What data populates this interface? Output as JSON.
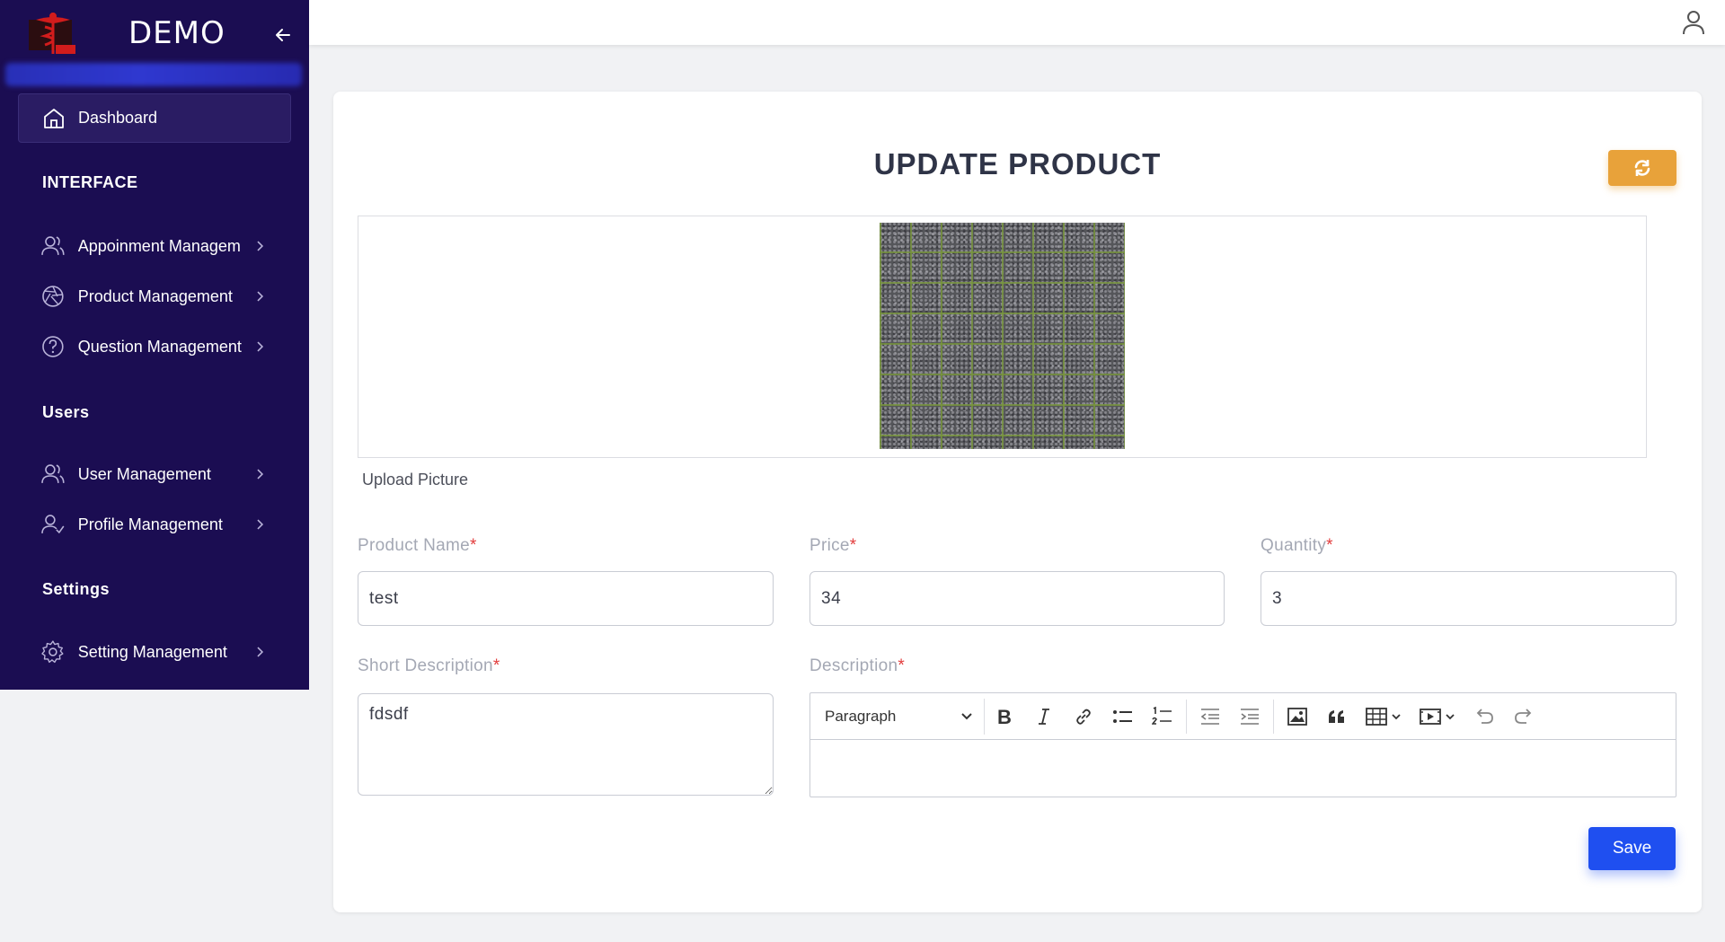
{
  "sidebar": {
    "brand": "DEMO",
    "dashboard_label": "Dashboard",
    "sections": {
      "interface": "INTERFACE",
      "users": "Users",
      "settings": "Settings"
    },
    "items": {
      "appointment": "Appoinment Managem",
      "product": "Product Management",
      "question": "Question Management",
      "user": "User Management",
      "profile": "Profile Management",
      "setting": "Setting Management"
    }
  },
  "page": {
    "title": "UPDATE PRODUCT",
    "upload_label": "Upload Picture"
  },
  "form": {
    "product_name": {
      "label": "Product Name",
      "value": "test"
    },
    "price": {
      "label": "Price",
      "value": "34"
    },
    "quantity": {
      "label": "Quantity",
      "value": "3"
    },
    "short_description": {
      "label": "Short Description",
      "value": "fdsdf"
    },
    "description": {
      "label": "Description",
      "value": ""
    },
    "required_mark": "*"
  },
  "editor": {
    "block_format": "Paragraph"
  },
  "actions": {
    "save": "Save"
  },
  "colors": {
    "sidebar_bg": "#1b0d52",
    "accent_blue": "#1f4ff0",
    "refresh_orange": "#e8a23a",
    "required_red": "#e23c3c"
  }
}
